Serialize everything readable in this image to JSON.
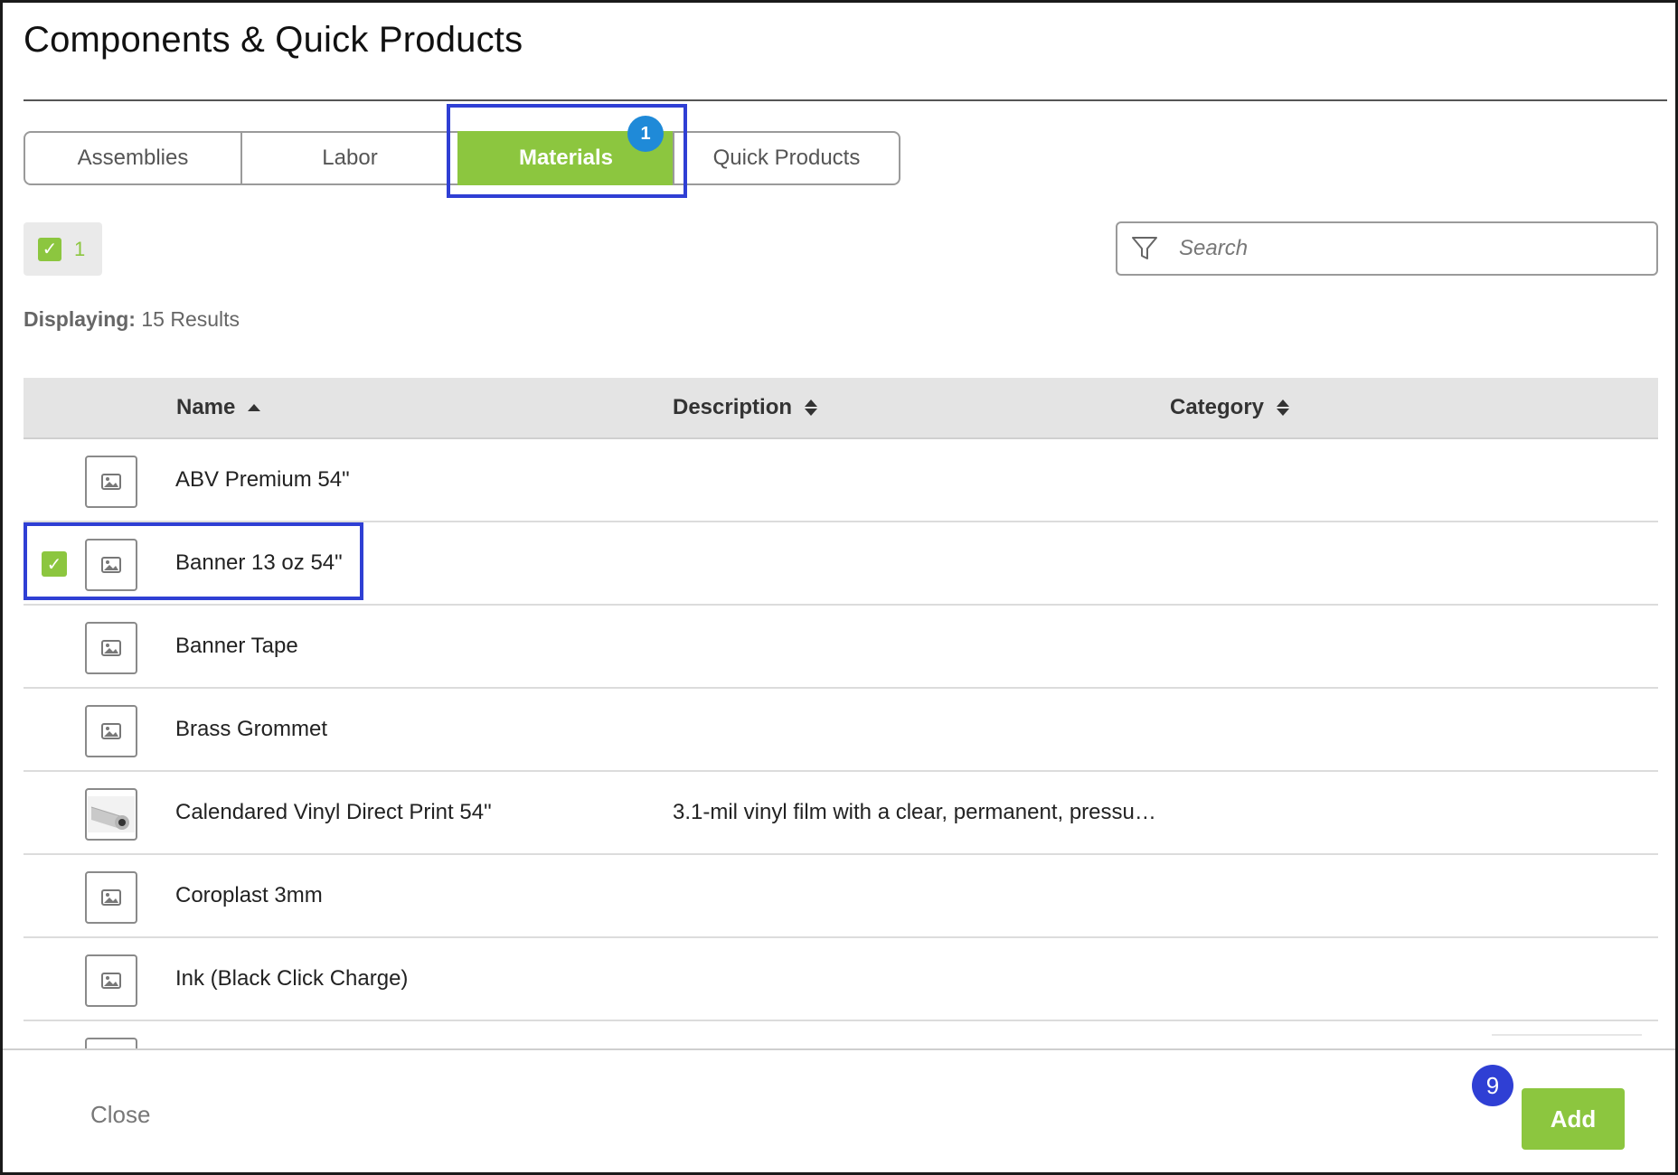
{
  "dialog": {
    "title": "Components & Quick Products"
  },
  "tabs": [
    {
      "label": "Assemblies",
      "active": false
    },
    {
      "label": "Labor",
      "active": false
    },
    {
      "label": "Materials",
      "active": true
    },
    {
      "label": "Quick Products",
      "active": false
    }
  ],
  "annotations": {
    "tab_step": "1",
    "add_step": "9",
    "highlight_color": "#2f3fd4"
  },
  "selection": {
    "count": "1"
  },
  "search": {
    "placeholder": "Search",
    "value": ""
  },
  "results": {
    "label": "Displaying:",
    "text": " 15 Results"
  },
  "table": {
    "columns": [
      {
        "label": "Name",
        "sort": "asc"
      },
      {
        "label": "Description",
        "sort": "none"
      },
      {
        "label": "Category",
        "sort": "none"
      }
    ],
    "rows": [
      {
        "name": "ABV Premium 54\"",
        "description": "",
        "category": "",
        "checked": false,
        "thumb": "image-placeholder-icon"
      },
      {
        "name": "Banner 13 oz 54\"",
        "description": "",
        "category": "",
        "checked": true,
        "thumb": "image-placeholder-icon"
      },
      {
        "name": "Banner Tape",
        "description": "",
        "category": "",
        "checked": false,
        "thumb": "image-placeholder-icon"
      },
      {
        "name": "Brass Grommet",
        "description": "",
        "category": "",
        "checked": false,
        "thumb": "image-placeholder-icon"
      },
      {
        "name": "Calendared Vinyl Direct Print 54\"",
        "description": "3.1-mil vinyl film with a clear, permanent, pressu…",
        "category": "",
        "checked": false,
        "thumb": "vinyl-roll-photo"
      },
      {
        "name": "Coroplast 3mm",
        "description": "",
        "category": "",
        "checked": false,
        "thumb": "image-placeholder-icon"
      },
      {
        "name": "Ink (Black Click Charge)",
        "description": "",
        "category": "",
        "checked": false,
        "thumb": "image-placeholder-icon"
      }
    ]
  },
  "footer": {
    "close_label": "Close",
    "add_label": "Add"
  },
  "colors": {
    "accent_green": "#8cc63f",
    "badge_blue": "#1f8ad8"
  }
}
